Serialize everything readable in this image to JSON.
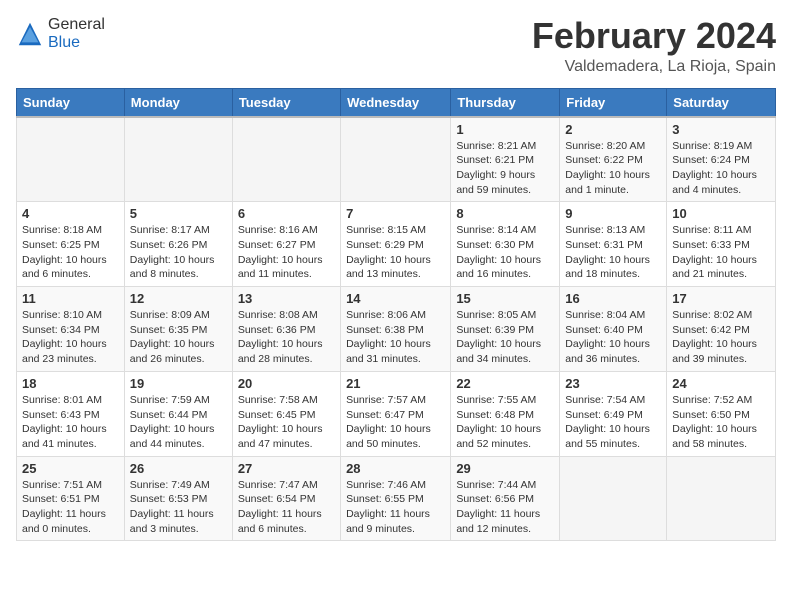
{
  "header": {
    "logo": {
      "general": "General",
      "blue": "Blue"
    },
    "title": "February 2024",
    "location": "Valdemadera, La Rioja, Spain"
  },
  "weekdays": [
    "Sunday",
    "Monday",
    "Tuesday",
    "Wednesday",
    "Thursday",
    "Friday",
    "Saturday"
  ],
  "weeks": [
    [
      {
        "day": "",
        "info": ""
      },
      {
        "day": "",
        "info": ""
      },
      {
        "day": "",
        "info": ""
      },
      {
        "day": "",
        "info": ""
      },
      {
        "day": "1",
        "info": "Sunrise: 8:21 AM\nSunset: 6:21 PM\nDaylight: 9 hours and 59 minutes."
      },
      {
        "day": "2",
        "info": "Sunrise: 8:20 AM\nSunset: 6:22 PM\nDaylight: 10 hours and 1 minute."
      },
      {
        "day": "3",
        "info": "Sunrise: 8:19 AM\nSunset: 6:24 PM\nDaylight: 10 hours and 4 minutes."
      }
    ],
    [
      {
        "day": "4",
        "info": "Sunrise: 8:18 AM\nSunset: 6:25 PM\nDaylight: 10 hours and 6 minutes."
      },
      {
        "day": "5",
        "info": "Sunrise: 8:17 AM\nSunset: 6:26 PM\nDaylight: 10 hours and 8 minutes."
      },
      {
        "day": "6",
        "info": "Sunrise: 8:16 AM\nSunset: 6:27 PM\nDaylight: 10 hours and 11 minutes."
      },
      {
        "day": "7",
        "info": "Sunrise: 8:15 AM\nSunset: 6:29 PM\nDaylight: 10 hours and 13 minutes."
      },
      {
        "day": "8",
        "info": "Sunrise: 8:14 AM\nSunset: 6:30 PM\nDaylight: 10 hours and 16 minutes."
      },
      {
        "day": "9",
        "info": "Sunrise: 8:13 AM\nSunset: 6:31 PM\nDaylight: 10 hours and 18 minutes."
      },
      {
        "day": "10",
        "info": "Sunrise: 8:11 AM\nSunset: 6:33 PM\nDaylight: 10 hours and 21 minutes."
      }
    ],
    [
      {
        "day": "11",
        "info": "Sunrise: 8:10 AM\nSunset: 6:34 PM\nDaylight: 10 hours and 23 minutes."
      },
      {
        "day": "12",
        "info": "Sunrise: 8:09 AM\nSunset: 6:35 PM\nDaylight: 10 hours and 26 minutes."
      },
      {
        "day": "13",
        "info": "Sunrise: 8:08 AM\nSunset: 6:36 PM\nDaylight: 10 hours and 28 minutes."
      },
      {
        "day": "14",
        "info": "Sunrise: 8:06 AM\nSunset: 6:38 PM\nDaylight: 10 hours and 31 minutes."
      },
      {
        "day": "15",
        "info": "Sunrise: 8:05 AM\nSunset: 6:39 PM\nDaylight: 10 hours and 34 minutes."
      },
      {
        "day": "16",
        "info": "Sunrise: 8:04 AM\nSunset: 6:40 PM\nDaylight: 10 hours and 36 minutes."
      },
      {
        "day": "17",
        "info": "Sunrise: 8:02 AM\nSunset: 6:42 PM\nDaylight: 10 hours and 39 minutes."
      }
    ],
    [
      {
        "day": "18",
        "info": "Sunrise: 8:01 AM\nSunset: 6:43 PM\nDaylight: 10 hours and 41 minutes."
      },
      {
        "day": "19",
        "info": "Sunrise: 7:59 AM\nSunset: 6:44 PM\nDaylight: 10 hours and 44 minutes."
      },
      {
        "day": "20",
        "info": "Sunrise: 7:58 AM\nSunset: 6:45 PM\nDaylight: 10 hours and 47 minutes."
      },
      {
        "day": "21",
        "info": "Sunrise: 7:57 AM\nSunset: 6:47 PM\nDaylight: 10 hours and 50 minutes."
      },
      {
        "day": "22",
        "info": "Sunrise: 7:55 AM\nSunset: 6:48 PM\nDaylight: 10 hours and 52 minutes."
      },
      {
        "day": "23",
        "info": "Sunrise: 7:54 AM\nSunset: 6:49 PM\nDaylight: 10 hours and 55 minutes."
      },
      {
        "day": "24",
        "info": "Sunrise: 7:52 AM\nSunset: 6:50 PM\nDaylight: 10 hours and 58 minutes."
      }
    ],
    [
      {
        "day": "25",
        "info": "Sunrise: 7:51 AM\nSunset: 6:51 PM\nDaylight: 11 hours and 0 minutes."
      },
      {
        "day": "26",
        "info": "Sunrise: 7:49 AM\nSunset: 6:53 PM\nDaylight: 11 hours and 3 minutes."
      },
      {
        "day": "27",
        "info": "Sunrise: 7:47 AM\nSunset: 6:54 PM\nDaylight: 11 hours and 6 minutes."
      },
      {
        "day": "28",
        "info": "Sunrise: 7:46 AM\nSunset: 6:55 PM\nDaylight: 11 hours and 9 minutes."
      },
      {
        "day": "29",
        "info": "Sunrise: 7:44 AM\nSunset: 6:56 PM\nDaylight: 11 hours and 12 minutes."
      },
      {
        "day": "",
        "info": ""
      },
      {
        "day": "",
        "info": ""
      }
    ]
  ]
}
